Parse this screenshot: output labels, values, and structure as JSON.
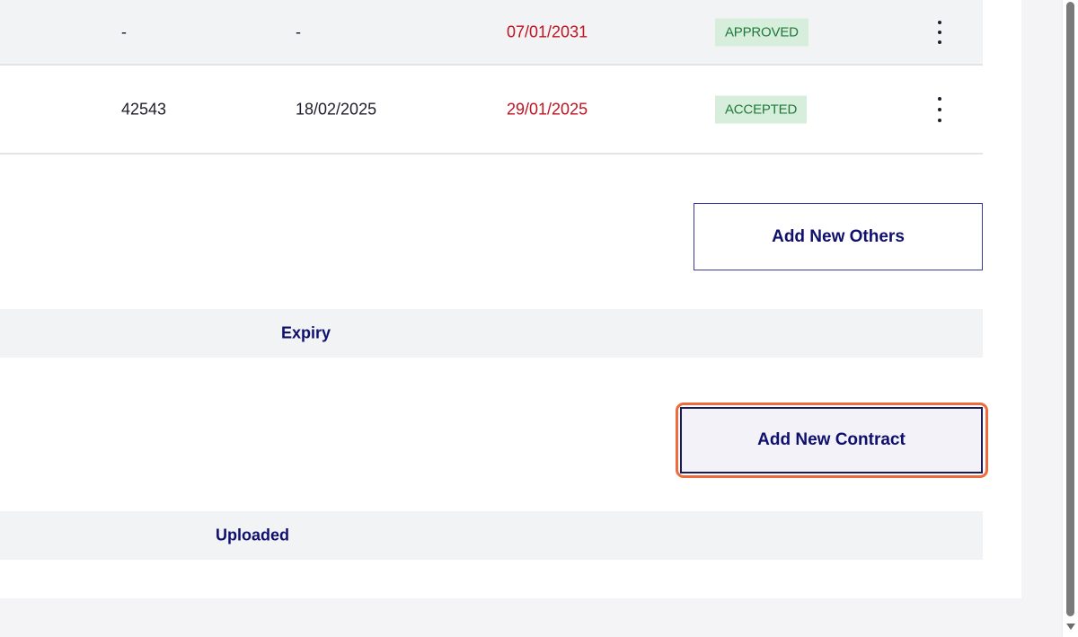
{
  "table": {
    "rows": [
      {
        "ref": "-",
        "date": "-",
        "expiry": "07/01/2031",
        "status": "APPROVED",
        "menu_icon": "kebab-menu-icon"
      },
      {
        "ref": "42543",
        "date": "18/02/2025",
        "expiry": "29/01/2025",
        "status": "ACCEPTED",
        "menu_icon": "kebab-menu-icon"
      }
    ]
  },
  "others_section": {
    "add_button_label": "Add New Others"
  },
  "contract_section": {
    "header_label": "Expiry",
    "add_button_label": "Add New Contract"
  },
  "uploaded_section": {
    "header_label": "Uploaded"
  },
  "colors": {
    "accent": "#0f0f6e",
    "expiry_date": "#c0121f",
    "status_badge_bg": "#d6eedb",
    "status_badge_text": "#1f7a3a",
    "focus_ring": "#ee6b3c"
  }
}
